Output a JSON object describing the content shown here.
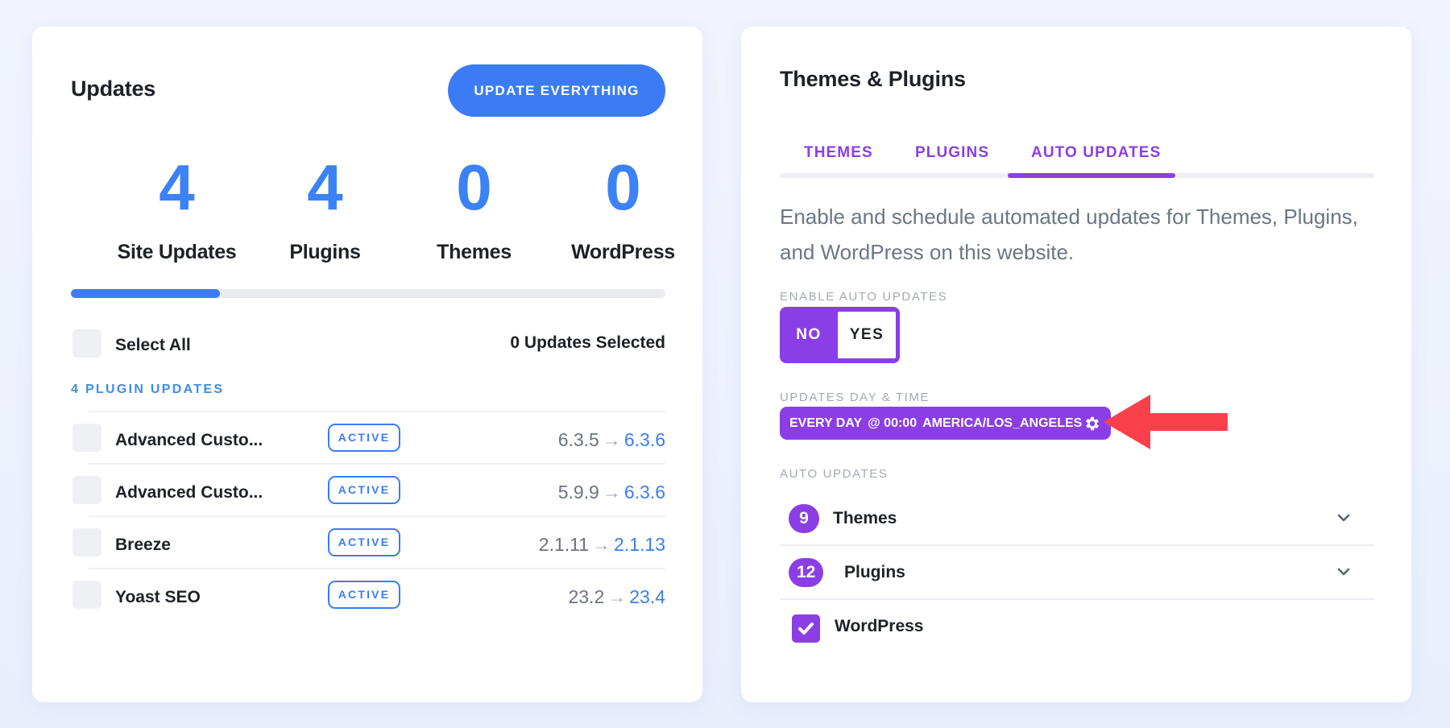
{
  "updates_card": {
    "title": "Updates",
    "update_everything_label": "UPDATE EVERYTHING",
    "stats": [
      {
        "value": "4",
        "label": "Site Updates"
      },
      {
        "value": "4",
        "label": "Plugins"
      },
      {
        "value": "0",
        "label": "Themes"
      },
      {
        "value": "0",
        "label": "WordPress"
      }
    ],
    "progress_fraction": 0.25,
    "select_all_label": "Select All",
    "selected_count": "0 Updates Selected",
    "plugin_updates_heading": "4 PLUGIN UPDATES",
    "plugins": [
      {
        "name": "Advanced Custo...",
        "status": "ACTIVE",
        "current_version": "6.3.5",
        "new_version": "6.3.6"
      },
      {
        "name": "Advanced Custo...",
        "status": "ACTIVE",
        "current_version": "5.9.9",
        "new_version": "6.3.6"
      },
      {
        "name": "Breeze",
        "status": "ACTIVE",
        "current_version": "2.1.11",
        "new_version": "2.1.13"
      },
      {
        "name": "Yoast SEO",
        "status": "ACTIVE",
        "current_version": "23.2",
        "new_version": "23.4"
      }
    ],
    "arrow_glyph": "→"
  },
  "themes_card": {
    "title": "Themes & Plugins",
    "tabs": [
      {
        "label": "THEMES",
        "active": false
      },
      {
        "label": "PLUGINS",
        "active": false
      },
      {
        "label": "AUTO UPDATES",
        "active": true
      }
    ],
    "description": "Enable and schedule automated updates for Themes, Plugins, and WordPress on this website.",
    "enable_label": "ENABLE AUTO UPDATES",
    "toggle": {
      "no_label": "NO",
      "yes_label": "YES",
      "selected": "YES"
    },
    "schedule_label": "UPDATES DAY & TIME",
    "schedule": {
      "frequency": "EVERY DAY",
      "time": "@ 00:00",
      "timezone": "AMERICA/LOS_ANGELES",
      "icon": "gear-icon"
    },
    "auto_updates_label": "AUTO UPDATES",
    "auto_updates": [
      {
        "count": "9",
        "label": "Themes",
        "icon": "chevron-down-icon"
      },
      {
        "count": "12",
        "label": "Plugins",
        "icon": "chevron-down-icon"
      },
      {
        "checked": true,
        "label": "WordPress",
        "icon": "check-icon"
      }
    ]
  },
  "colors": {
    "primary_blue": "#3b7cf6",
    "accent_purple": "#8b3ee6",
    "annotation_red": "#f9404b"
  }
}
